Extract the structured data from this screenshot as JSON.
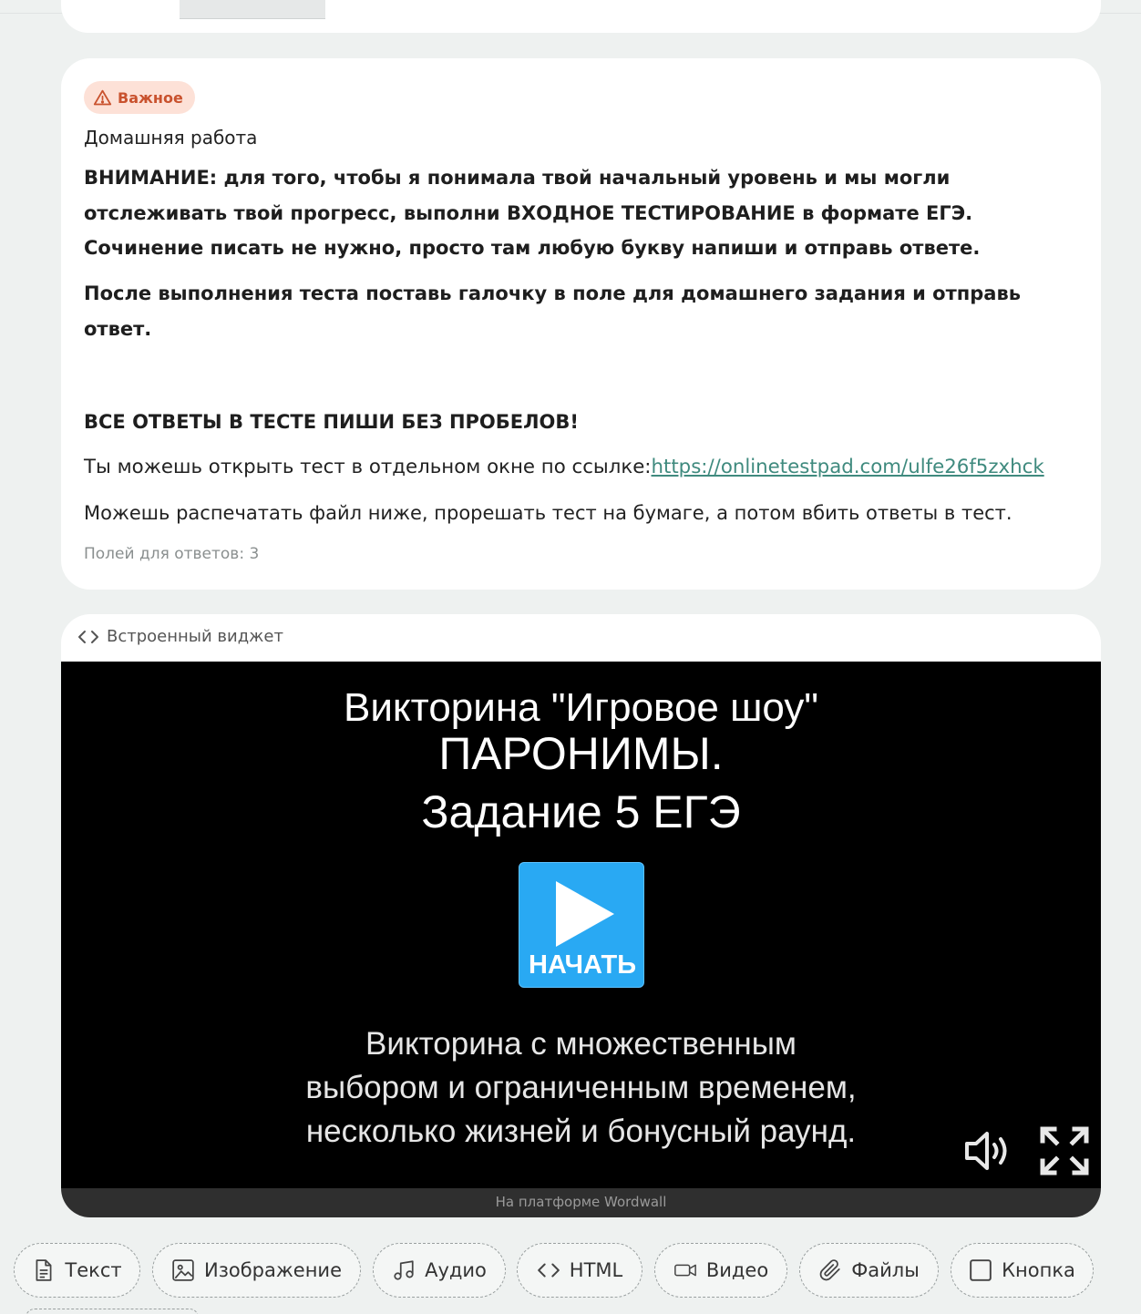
{
  "badge": {
    "label": "Важное"
  },
  "homework": {
    "title": "Домашняя работа",
    "para1": "ВНИМАНИЕ: для того, чтобы я понимала твой начальный уровень и мы могли отслеживать твой прогресс, выполни ВХОДНОЕ ТЕСТИРОВАНИЕ в формате ЕГЭ. Сочинение писать не нужно, просто там любую букву напиши и отправь ответе.",
    "para2": "После выполнения теста поставь галочку в поле для домашнего задания и отправь ответ.",
    "para3": "ВСЕ ОТВЕТЫ В ТЕСТЕ ПИШИ БЕЗ ПРОБЕЛОВ!",
    "link_text_prefix": "Ты можешь открыть тест в отдельном окне по ссылке:",
    "link_url": "https://onlinetestpad.com/ulfe26f5zxhck",
    "para5": "Можешь распечатать файл ниже, прорешать тест на бумаге, а потом вбить ответы в тест.",
    "fields_count": "Полей для ответов: 3"
  },
  "widget": {
    "header": "Встроенный виджет",
    "title_line1": "Викторина \"Игровое шоу\"",
    "title_line2": "ПАРОНИМЫ.",
    "title_line3": "Задание 5 ЕГЭ",
    "start_label": "НАЧАТЬ",
    "desc_line1": "Викторина с множественным",
    "desc_line2": "выбором и ограниченным временем,",
    "desc_line3": "несколько жизней и бонусный раунд.",
    "platform": "На платформе Wordwall"
  },
  "toolbar": {
    "items": [
      {
        "label": "Текст",
        "icon": "document-icon"
      },
      {
        "label": "Изображение",
        "icon": "image-icon"
      },
      {
        "label": "Аудио",
        "icon": "music-icon"
      },
      {
        "label": "HTML",
        "icon": "code-icon"
      },
      {
        "label": "Видео",
        "icon": "video-icon"
      },
      {
        "label": "Файлы",
        "icon": "paperclip-icon"
      },
      {
        "label": "Кнопка",
        "icon": "square-icon"
      }
    ]
  },
  "colors": {
    "accent": "#3f8a7e",
    "badge_bg": "#fde1d7",
    "badge_text": "#c9522e",
    "play_button": "#29a9f3"
  }
}
